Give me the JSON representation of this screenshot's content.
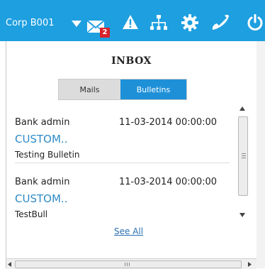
{
  "header": {
    "corp_label": "Corp B001",
    "mail_badge": "2",
    "icons": [
      "mail-icon",
      "warning-icon",
      "hierarchy-icon",
      "gear-icon",
      "phone-icon",
      "power-icon"
    ],
    "accent_color": "#1e9fe0"
  },
  "panel": {
    "title": "INBOX",
    "tabs": [
      {
        "label": "Mails",
        "active": false
      },
      {
        "label": "Bulletins",
        "active": true
      }
    ],
    "items": [
      {
        "sender": "Bank admin",
        "date": "11-03-2014 00:00:00",
        "subject": "CUSTOM..",
        "body": "Testing Bulletin"
      },
      {
        "sender": "Bank admin",
        "date": "11-03-2014 00:00:00",
        "subject": "CUSTOM..",
        "body": "TestBull"
      }
    ],
    "see_all": "See All"
  }
}
